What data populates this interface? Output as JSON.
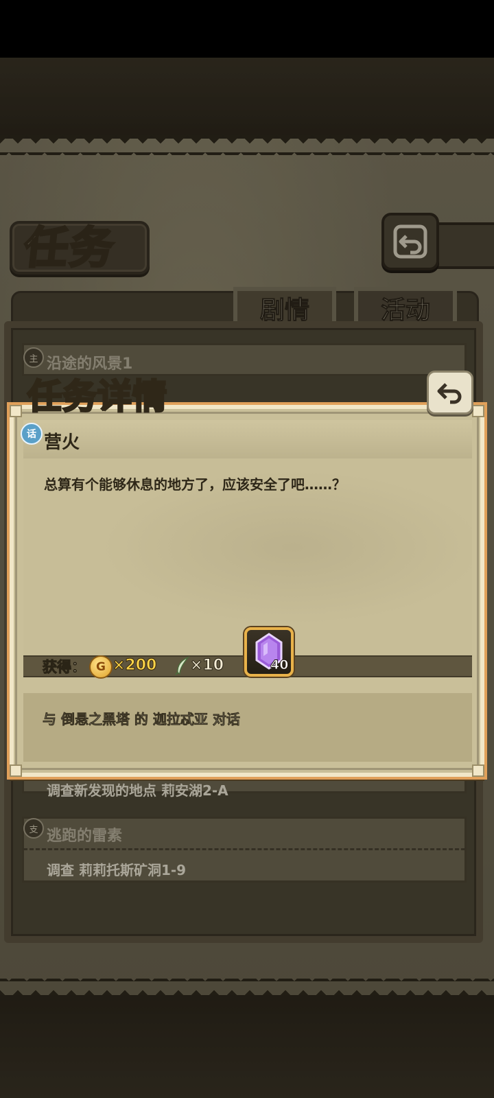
{
  "header": {
    "title": "任务"
  },
  "tabs": [
    {
      "label": "剧情",
      "active": true
    },
    {
      "label": "活动",
      "active": false
    }
  ],
  "quest_list": [
    {
      "badge": "主",
      "title": "沿途的风景1",
      "task": ""
    },
    {
      "badge": "",
      "title": "",
      "task": "调查新发现的地点 莉安湖2-A"
    },
    {
      "badge": "支",
      "title": "逃跑的雷素",
      "task": "调查 莉莉托斯矿洞1-9"
    }
  ],
  "modal": {
    "title": "任务详情",
    "quest_badge": "话",
    "quest_name": "营火",
    "description": "总算有个能够休息的地方了，应该安全了吧……？",
    "reward_label": "获得：",
    "coin_symbol": "G",
    "gold": "×200",
    "exp": "×10",
    "gem_count": "40",
    "task": "与 倒悬之黑塔 的 迦拉忒亚 对话"
  },
  "colors": {
    "parchment": "#c9bf99",
    "modal_border_accent": "#e0a05a",
    "gold_text": "#ffd64a",
    "gem": "#9a5bd8"
  }
}
